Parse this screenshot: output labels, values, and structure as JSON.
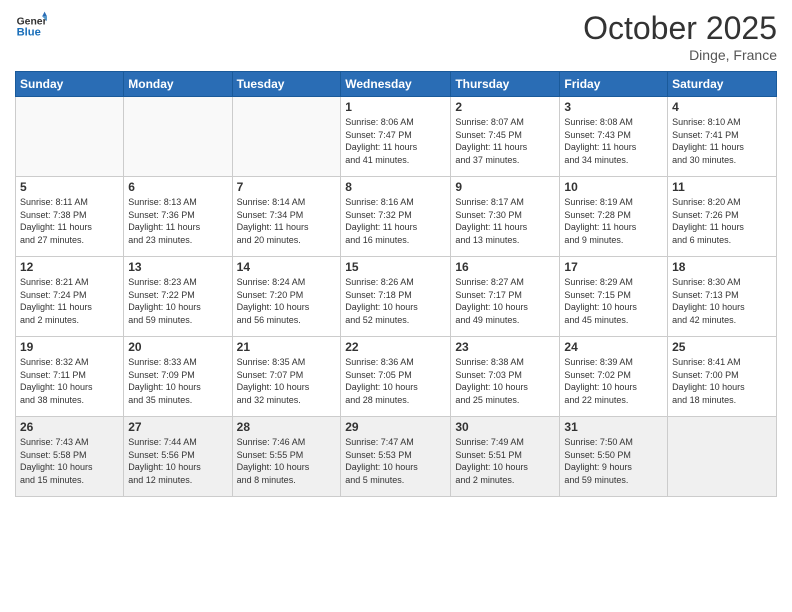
{
  "header": {
    "logo_line1": "General",
    "logo_line2": "Blue",
    "month": "October 2025",
    "location": "Dinge, France"
  },
  "weekdays": [
    "Sunday",
    "Monday",
    "Tuesday",
    "Wednesday",
    "Thursday",
    "Friday",
    "Saturday"
  ],
  "weeks": [
    [
      {
        "day": "",
        "info": ""
      },
      {
        "day": "",
        "info": ""
      },
      {
        "day": "",
        "info": ""
      },
      {
        "day": "1",
        "info": "Sunrise: 8:06 AM\nSunset: 7:47 PM\nDaylight: 11 hours\nand 41 minutes."
      },
      {
        "day": "2",
        "info": "Sunrise: 8:07 AM\nSunset: 7:45 PM\nDaylight: 11 hours\nand 37 minutes."
      },
      {
        "day": "3",
        "info": "Sunrise: 8:08 AM\nSunset: 7:43 PM\nDaylight: 11 hours\nand 34 minutes."
      },
      {
        "day": "4",
        "info": "Sunrise: 8:10 AM\nSunset: 7:41 PM\nDaylight: 11 hours\nand 30 minutes."
      }
    ],
    [
      {
        "day": "5",
        "info": "Sunrise: 8:11 AM\nSunset: 7:38 PM\nDaylight: 11 hours\nand 27 minutes."
      },
      {
        "day": "6",
        "info": "Sunrise: 8:13 AM\nSunset: 7:36 PM\nDaylight: 11 hours\nand 23 minutes."
      },
      {
        "day": "7",
        "info": "Sunrise: 8:14 AM\nSunset: 7:34 PM\nDaylight: 11 hours\nand 20 minutes."
      },
      {
        "day": "8",
        "info": "Sunrise: 8:16 AM\nSunset: 7:32 PM\nDaylight: 11 hours\nand 16 minutes."
      },
      {
        "day": "9",
        "info": "Sunrise: 8:17 AM\nSunset: 7:30 PM\nDaylight: 11 hours\nand 13 minutes."
      },
      {
        "day": "10",
        "info": "Sunrise: 8:19 AM\nSunset: 7:28 PM\nDaylight: 11 hours\nand 9 minutes."
      },
      {
        "day": "11",
        "info": "Sunrise: 8:20 AM\nSunset: 7:26 PM\nDaylight: 11 hours\nand 6 minutes."
      }
    ],
    [
      {
        "day": "12",
        "info": "Sunrise: 8:21 AM\nSunset: 7:24 PM\nDaylight: 11 hours\nand 2 minutes."
      },
      {
        "day": "13",
        "info": "Sunrise: 8:23 AM\nSunset: 7:22 PM\nDaylight: 10 hours\nand 59 minutes."
      },
      {
        "day": "14",
        "info": "Sunrise: 8:24 AM\nSunset: 7:20 PM\nDaylight: 10 hours\nand 56 minutes."
      },
      {
        "day": "15",
        "info": "Sunrise: 8:26 AM\nSunset: 7:18 PM\nDaylight: 10 hours\nand 52 minutes."
      },
      {
        "day": "16",
        "info": "Sunrise: 8:27 AM\nSunset: 7:17 PM\nDaylight: 10 hours\nand 49 minutes."
      },
      {
        "day": "17",
        "info": "Sunrise: 8:29 AM\nSunset: 7:15 PM\nDaylight: 10 hours\nand 45 minutes."
      },
      {
        "day": "18",
        "info": "Sunrise: 8:30 AM\nSunset: 7:13 PM\nDaylight: 10 hours\nand 42 minutes."
      }
    ],
    [
      {
        "day": "19",
        "info": "Sunrise: 8:32 AM\nSunset: 7:11 PM\nDaylight: 10 hours\nand 38 minutes."
      },
      {
        "day": "20",
        "info": "Sunrise: 8:33 AM\nSunset: 7:09 PM\nDaylight: 10 hours\nand 35 minutes."
      },
      {
        "day": "21",
        "info": "Sunrise: 8:35 AM\nSunset: 7:07 PM\nDaylight: 10 hours\nand 32 minutes."
      },
      {
        "day": "22",
        "info": "Sunrise: 8:36 AM\nSunset: 7:05 PM\nDaylight: 10 hours\nand 28 minutes."
      },
      {
        "day": "23",
        "info": "Sunrise: 8:38 AM\nSunset: 7:03 PM\nDaylight: 10 hours\nand 25 minutes."
      },
      {
        "day": "24",
        "info": "Sunrise: 8:39 AM\nSunset: 7:02 PM\nDaylight: 10 hours\nand 22 minutes."
      },
      {
        "day": "25",
        "info": "Sunrise: 8:41 AM\nSunset: 7:00 PM\nDaylight: 10 hours\nand 18 minutes."
      }
    ],
    [
      {
        "day": "26",
        "info": "Sunrise: 7:43 AM\nSunset: 5:58 PM\nDaylight: 10 hours\nand 15 minutes."
      },
      {
        "day": "27",
        "info": "Sunrise: 7:44 AM\nSunset: 5:56 PM\nDaylight: 10 hours\nand 12 minutes."
      },
      {
        "day": "28",
        "info": "Sunrise: 7:46 AM\nSunset: 5:55 PM\nDaylight: 10 hours\nand 8 minutes."
      },
      {
        "day": "29",
        "info": "Sunrise: 7:47 AM\nSunset: 5:53 PM\nDaylight: 10 hours\nand 5 minutes."
      },
      {
        "day": "30",
        "info": "Sunrise: 7:49 AM\nSunset: 5:51 PM\nDaylight: 10 hours\nand 2 minutes."
      },
      {
        "day": "31",
        "info": "Sunrise: 7:50 AM\nSunset: 5:50 PM\nDaylight: 9 hours\nand 59 minutes."
      },
      {
        "day": "",
        "info": ""
      }
    ]
  ]
}
